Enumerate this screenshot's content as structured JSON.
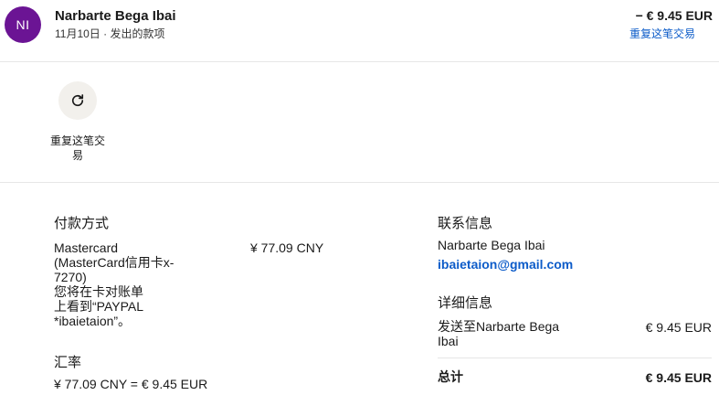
{
  "header": {
    "avatar_initials": "NI",
    "avatar_color": "#6b1494",
    "merchant_name": "Narbarte Bega Ibai",
    "subtitle": "11月10日 · 发出的款项",
    "amount": "− € 9.45 EUR",
    "repeat_link": "重复这笔交易"
  },
  "actions": {
    "repeat": {
      "icon": "refresh-icon",
      "label": "重复这笔交易"
    }
  },
  "payment": {
    "title": "付款方式",
    "method_lines": [
      "Mastercard",
      "(MasterCard信用卡x-",
      "7270)",
      "您将在卡对账单",
      "上看到“PAYPAL",
      "*ibaietaion”。"
    ],
    "method_amount": "¥ 77.09 CNY",
    "rate_title": "汇率",
    "rate_value": "¥ 77.09 CNY = € 9.45 EUR"
  },
  "contact": {
    "title": "联系信息",
    "name": "Narbarte Bega Ibai",
    "email": "ibaietaion@gmail.com"
  },
  "details": {
    "title": "详细信息",
    "sent_to_lines": [
      "发送至Narbarte Bega",
      "Ibai"
    ],
    "sent_amount": "€ 9.45 EUR",
    "total_label": "总计",
    "total_amount": "€ 9.45 EUR"
  },
  "colors": {
    "link": "#0d5cc9",
    "divider": "#e6e6e6",
    "action_bg": "#f2f0ec"
  }
}
